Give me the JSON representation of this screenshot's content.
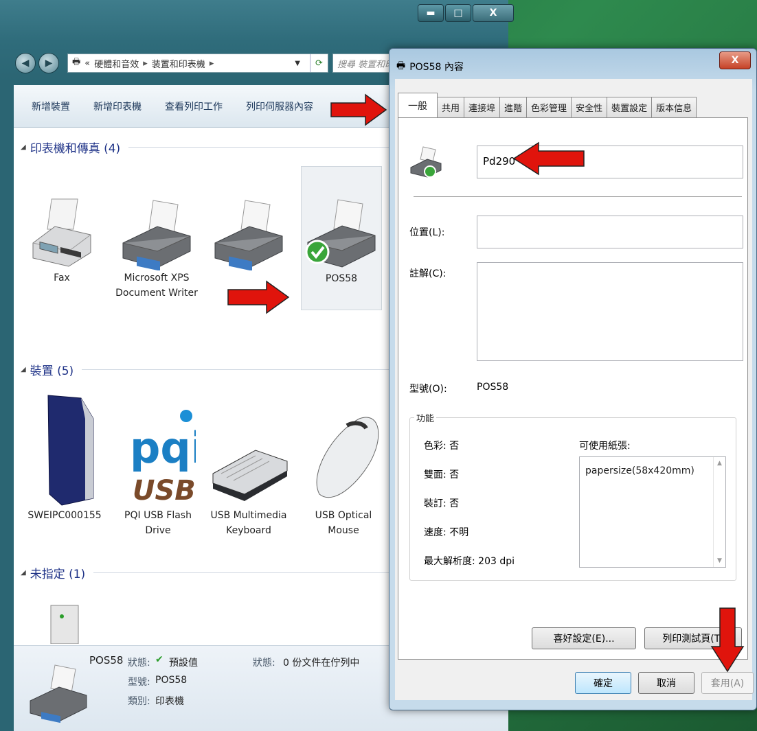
{
  "explorer": {
    "window_buttons": {
      "minimize": "▬",
      "maximize": "□",
      "close": "X"
    },
    "breadcrumb": [
      "«",
      "硬體和音效",
      "装置和印表機"
    ],
    "search_placeholder": "搜尋 裝置和印表機",
    "commands": [
      "新增裝置",
      "新增印表機",
      "查看列印工作",
      "列印伺服器內容"
    ],
    "groups": [
      {
        "title": "印表機和傳真 (4)"
      },
      {
        "title": "裝置 (5)"
      },
      {
        "title": "未指定 (1)"
      }
    ],
    "printers": [
      {
        "label": "Fax"
      },
      {
        "label": "Microsoft XPS Document Writer"
      },
      {
        "label": ""
      },
      {
        "label": "POS58"
      }
    ],
    "devices": [
      {
        "label": "SWEIPC000155"
      },
      {
        "label": "PQI USB Flash Drive"
      },
      {
        "label": "USB Multimedia Keyboard"
      },
      {
        "label": "USB Optical Mouse"
      }
    ],
    "pqi_logo": {
      "brand": "pqi",
      "sub": "USB"
    },
    "details": {
      "name": "POS58",
      "status_label": "狀態:",
      "status_value": "預設值",
      "model_label": "型號:",
      "model_value": "POS58",
      "category_label": "類別:",
      "category_value": "印表機",
      "queue_label": "狀態:",
      "queue_value": "0 份文件在佇列中"
    }
  },
  "dialog": {
    "title": "POS58 內容",
    "close": "X",
    "tabs": [
      "一般",
      "共用",
      "連接埠",
      "進階",
      "色彩管理",
      "安全性",
      "裝置設定",
      "版本信息"
    ],
    "printer_name": "Pd290",
    "location_label": "位置(L):",
    "location_value": "",
    "comment_label": "註解(C):",
    "comment_value": "",
    "model_label": "型號(O):",
    "model_value": "POS58",
    "features_legend": "功能",
    "features": {
      "color": "色彩: 否",
      "duplex": "雙面: 否",
      "staple": "裝訂: 否",
      "speed": "速度: 不明",
      "max_res": "最大解析度: 203 dpi",
      "paper_label": "可使用紙張:",
      "paper_items": [
        "papersize(58x420mm)"
      ]
    },
    "buttons": {
      "preferences": "喜好設定(E)...",
      "test_page": "列印測試頁(T)",
      "ok": "確定",
      "cancel": "取消",
      "apply": "套用(A)"
    }
  },
  "colors": {
    "arrow": "#e0140c",
    "link_text": "#1e3287"
  }
}
